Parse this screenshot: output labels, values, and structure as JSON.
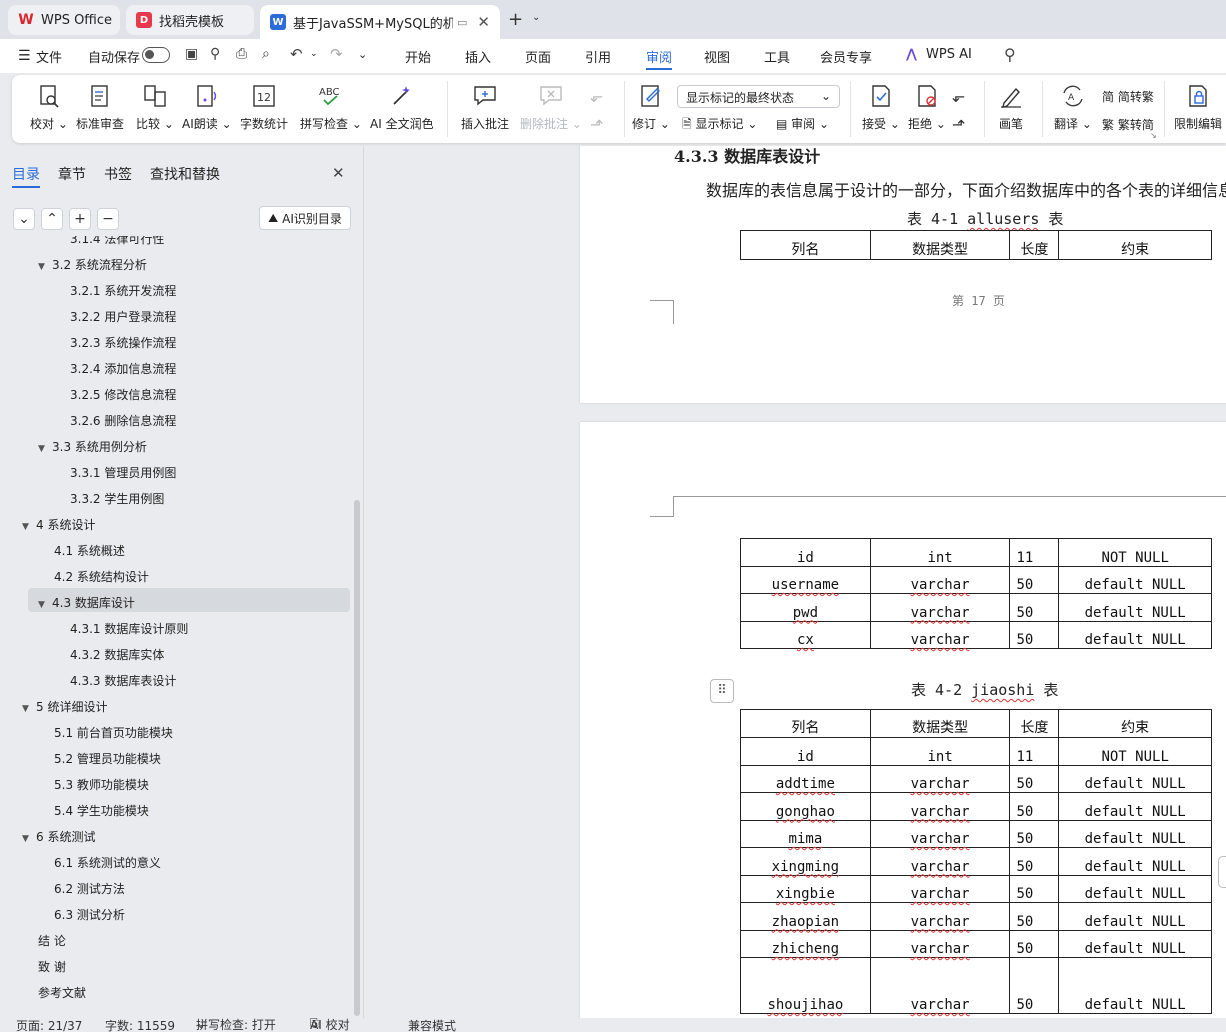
{
  "tabs": [
    {
      "label": "WPS Office",
      "icon": "wps-logo-icon",
      "color": "#d9272e"
    },
    {
      "label": "找稻壳模板",
      "icon": "docer-icon",
      "color": "#e8394c"
    },
    {
      "label": "基于JavaSSM+MySQL的机房",
      "icon": "word-doc-icon",
      "color": "#2b6cd9"
    }
  ],
  "menu": {
    "file": "文件",
    "autosave": "自动保存",
    "items": [
      "开始",
      "插入",
      "页面",
      "引用",
      "审阅",
      "视图",
      "工具",
      "会员专享"
    ],
    "active": "审阅",
    "ai": "WPS AI"
  },
  "ribbon": {
    "proofread": "校对",
    "standard_review": "标准审查",
    "compare": "比较",
    "ai_read": "AI朗读",
    "word_count": "字数统计",
    "spell_check": "拼写检查",
    "ai_polish": "AI 全文润色",
    "insert_comment": "插入批注",
    "delete_comment": "删除批注",
    "track_changes": "修订",
    "display_select": "显示标记的最终状态",
    "show_markup": "显示标记",
    "review_pane": "审阅",
    "accept": "接受",
    "reject": "拒绝",
    "pen": "画笔",
    "translate": "翻译",
    "to_traditional": "简转繁",
    "to_simplified": "繁转简",
    "restrict_edit": "限制编辑"
  },
  "sidebar": {
    "tabs": [
      "目录",
      "章节",
      "书签",
      "查找和替换"
    ],
    "active_tab": "目录",
    "ai_toc": "AI识别目录",
    "toc": [
      {
        "text": "3.1.4  法律可行性",
        "level": 3
      },
      {
        "text": "3.2 系统流程分析",
        "level": 2,
        "expanded": true
      },
      {
        "text": "3.2.1 系统开发流程",
        "level": 3
      },
      {
        "text": "3.2.2  用户登录流程",
        "level": 3
      },
      {
        "text": "3.2.3  系统操作流程",
        "level": 3
      },
      {
        "text": "3.2.4  添加信息流程",
        "level": 3
      },
      {
        "text": "3.2.5  修改信息流程",
        "level": 3
      },
      {
        "text": "3.2.6  删除信息流程",
        "level": 3
      },
      {
        "text": "3.3 系统用例分析",
        "level": 2,
        "expanded": true
      },
      {
        "text": "3.3.1 管理员用例图",
        "level": 3
      },
      {
        "text": "3.3.2 学生用例图",
        "level": 3
      },
      {
        "text": "4  系统设计",
        "level": 1,
        "expanded": true
      },
      {
        "text": "4.1  系统概述",
        "level": 2
      },
      {
        "text": "4.2  系统结构设计",
        "level": 2
      },
      {
        "text": "4.3 数据库设计",
        "level": 2,
        "expanded": true,
        "selected": true
      },
      {
        "text": "4.3.1  数据库设计原则",
        "level": 3
      },
      {
        "text": "4.3.2  数据库实体",
        "level": 3
      },
      {
        "text": "4.3.3  数据库表设计",
        "level": 3
      },
      {
        "text": "5 统详细设计",
        "level": 1,
        "expanded": true
      },
      {
        "text": "5.1 前台首页功能模块",
        "level": 2
      },
      {
        "text": "5.2 管理员功能模块",
        "level": 2
      },
      {
        "text": "5.3 教师功能模块",
        "level": 2
      },
      {
        "text": "5.4 学生功能模块",
        "level": 2
      },
      {
        "text": "6 系统测试",
        "level": 1,
        "expanded": true
      },
      {
        "text": "6.1 系统测试的意义",
        "level": 2
      },
      {
        "text": "6.2  测试方法",
        "level": 2
      },
      {
        "text": "6.3 测试分析",
        "level": 2
      },
      {
        "text": "结      论",
        "level": 1
      },
      {
        "text": "致      谢",
        "level": 1
      },
      {
        "text": "参考文献",
        "level": 1
      }
    ]
  },
  "document": {
    "heading": "4.3.3  数据库表设计",
    "intro": "数据库的表信息属于设计的一部分，下面介绍数据库中的各个表的详细信息",
    "table1_caption_prefix": "表 4-1 ",
    "table1_caption_name": "allusers",
    "table1_caption_suffix": " 表",
    "headers": [
      "列名",
      "数据类型",
      "长度",
      "约束"
    ],
    "footer": "第 17 页",
    "table1_rows": [
      [
        "id",
        "int",
        "11",
        "NOT NULL"
      ],
      [
        "username",
        "varchar",
        "50",
        "default NULL"
      ],
      [
        "pwd",
        "varchar",
        "50",
        "default NULL"
      ],
      [
        "cx",
        "varchar",
        "50",
        "default NULL"
      ]
    ],
    "table2_caption_prefix": "表 4-2 ",
    "table2_caption_name": "jiaoshi",
    "table2_caption_suffix": " 表",
    "table2_rows": [
      [
        "id",
        "int",
        "11",
        "NOT NULL"
      ],
      [
        "addtime",
        "varchar",
        "50",
        "default NULL"
      ],
      [
        "gonghao",
        "varchar",
        "50",
        "default NULL"
      ],
      [
        "mima",
        "varchar",
        "50",
        "default NULL"
      ],
      [
        "xingming",
        "varchar",
        "50",
        "default NULL"
      ],
      [
        "xingbie",
        "varchar",
        "50",
        "default NULL"
      ],
      [
        "zhaopian",
        "varchar",
        "50",
        "default NULL"
      ],
      [
        "zhicheng",
        "varchar",
        "50",
        "default NULL"
      ],
      [
        "shoujihao",
        "varchar",
        "50",
        "default NULL"
      ]
    ]
  },
  "status": {
    "page": "页面: 21/37",
    "words": "字数: 11559",
    "spell": "拼写检查: 打开",
    "ai_proof": "AI 校对",
    "compat": "兼容模式"
  }
}
